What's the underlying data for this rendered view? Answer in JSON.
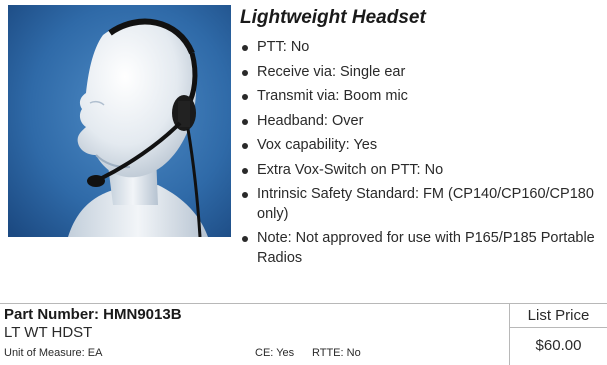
{
  "product": {
    "title": "Lightweight Headset",
    "image_alt": "headset-on-mannequin",
    "features": [
      "PTT: No",
      "Receive via: Single ear",
      "Transmit via: Boom mic",
      "Headband: Over",
      "Vox capability: Yes",
      "Extra Vox-Switch on PTT: No",
      "Intrinsic Safety Standard: FM (CP140/CP160/CP180 only)",
      "Note: Not approved for use with P165/P185 Portable Radios"
    ]
  },
  "info": {
    "part_number": "Part Number: HMN9013B",
    "description": "LT WT HDST",
    "unit_of_measure": "Unit of Measure: EA",
    "ce": "CE: Yes",
    "rtte": "RTTE: No",
    "price_label": "List Price",
    "price": "$60.00"
  },
  "colors": {
    "background": "#ffffff",
    "text": "#2a2a2a",
    "border": "#b8b8b8",
    "image_bg": "#2e6aa8"
  }
}
